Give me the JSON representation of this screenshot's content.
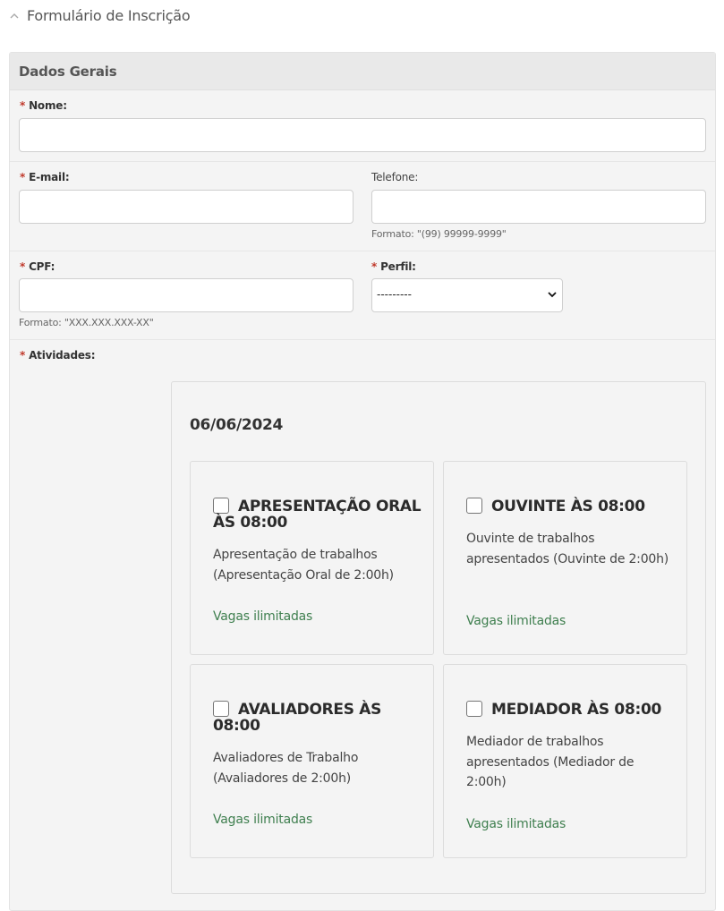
{
  "header": {
    "title": "Formulário de Inscrição"
  },
  "panel": {
    "title": "Dados Gerais"
  },
  "form": {
    "required_marker": "*",
    "nome": {
      "label": "Nome:",
      "value": ""
    },
    "email": {
      "label": "E-mail:",
      "value": ""
    },
    "telefone": {
      "label": "Telefone:",
      "value": "",
      "help": "Formato: \"(99) 99999-9999\""
    },
    "cpf": {
      "label": "CPF:",
      "value": "",
      "help": "Formato: \"XXX.XXX.XXX-XX\""
    },
    "perfil": {
      "label": "Perfil:",
      "selected": "---------"
    },
    "atividades": {
      "label": "Atividades:"
    }
  },
  "activities": {
    "date": "06/06/2024",
    "items": [
      {
        "title": "APRESENTAÇÃO ORAL ÀS 08:00",
        "description": "Apresentação de trabalhos (Apresentação Oral de 2:00h)",
        "vagas": "Vagas ilimitadas",
        "checked": false
      },
      {
        "title": "OUVINTE ÀS 08:00",
        "description": "Ouvinte de trabalhos apresentados (Ouvinte de 2:00h)",
        "vagas": "Vagas ilimitadas",
        "checked": false
      },
      {
        "title": "AVALIADORES ÀS 08:00",
        "description": "Avaliadores de Trabalho (Avaliadores de 2:00h)",
        "vagas": "Vagas ilimitadas",
        "checked": false
      },
      {
        "title": "MEDIADOR ÀS 08:00",
        "description": "Mediador de trabalhos apresentados (Mediador de 2:00h)",
        "vagas": "Vagas ilimitadas",
        "checked": false
      }
    ]
  },
  "colors": {
    "required": "#c0392b",
    "vagas": "#3f7f4f",
    "panel_bg": "#f4f4f4",
    "panel_header_bg": "#e9e9e9"
  }
}
